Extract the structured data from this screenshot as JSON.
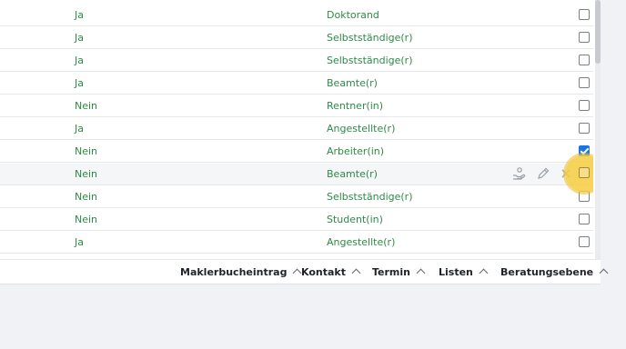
{
  "rows": [
    {
      "col1": "Ja",
      "col2": "Doktorand",
      "checked": false
    },
    {
      "col1": "Ja",
      "col2": "Selbstständige(r)",
      "checked": false
    },
    {
      "col1": "Ja",
      "col2": "Selbstständige(r)",
      "checked": false
    },
    {
      "col1": "Ja",
      "col2": "Beamte(r)",
      "checked": false
    },
    {
      "col1": "Nein",
      "col2": "Rentner(in)",
      "checked": false
    },
    {
      "col1": "Ja",
      "col2": "Angestellte(r)",
      "checked": false
    },
    {
      "col1": "Nein",
      "col2": "Arbeiter(in)",
      "checked": true
    },
    {
      "col1": "Nein",
      "col2": "Beamte(r)",
      "checked": false
    },
    {
      "col1": "Nein",
      "col2": "Selbstständige(r)",
      "checked": false
    },
    {
      "col1": "Nein",
      "col2": "Student(in)",
      "checked": false
    },
    {
      "col1": "Ja",
      "col2": "Angestellte(r)",
      "checked": false
    }
  ],
  "row_icons": [
    "hand-coin-icon",
    "pencil-icon",
    "close-icon"
  ],
  "footer": {
    "items": [
      "Maklerbucheintrag",
      "Kontakt",
      "Termin",
      "Listen",
      "Beratungsebene"
    ]
  },
  "colors": {
    "text_green": "#2e8a47",
    "checkbox_blue": "#1a73e8",
    "highlight": "#f6cc40"
  }
}
